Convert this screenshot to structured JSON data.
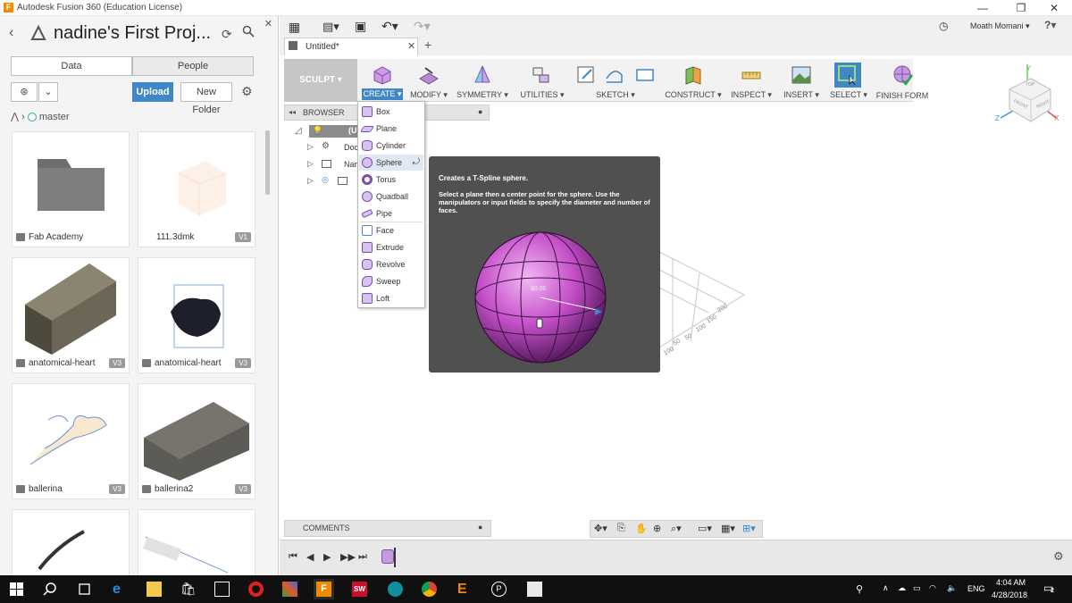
{
  "window": {
    "title": "Autodesk Fusion 360 (Education License)",
    "controls": [
      "—",
      "❐",
      "✕"
    ]
  },
  "data_panel": {
    "project_title": "nadine's First Proj...",
    "tabs": [
      "Data",
      "People"
    ],
    "upload_label": "Upload",
    "new_folder_label": "New Folder",
    "branch": "master",
    "cards": [
      {
        "name": "Fab Academy",
        "version": ""
      },
      {
        "name": "111.3dmk",
        "version": "V1"
      },
      {
        "name": "anatomical-heart",
        "version": "V3"
      },
      {
        "name": "anatomical-heart",
        "version": "V3"
      },
      {
        "name": "ballerina",
        "version": "V3"
      },
      {
        "name": "ballerina2",
        "version": "V3"
      }
    ]
  },
  "app_bar": {
    "user": "Moath Momani ▾",
    "help": "?",
    "doc_tab": "Untitled*"
  },
  "toolbar": {
    "workspace": "SCULPT ▾",
    "groups": [
      "CREATE ▾",
      "MODIFY ▾",
      "SYMMETRY ▾",
      "UTILITIES ▾",
      "SKETCH ▾",
      "CONSTRUCT ▾",
      "INSPECT ▾",
      "INSERT ▾",
      "SELECT ▾",
      "FINISH FORM"
    ]
  },
  "browser": {
    "title": "BROWSER",
    "rows": [
      "(U",
      "Doc",
      "Nam",
      ""
    ]
  },
  "create_menu": {
    "items": [
      "Box",
      "Plane",
      "Cylinder",
      "Sphere",
      "Torus",
      "Quadball",
      "Pipe",
      "Face",
      "Extrude",
      "Revolve",
      "Sweep",
      "Loft"
    ],
    "highlighted": "Sphere"
  },
  "tooltip": {
    "title": "Creates a T-Spline sphere.",
    "body": "Select a plane then a center point for the sphere. Use the manipulators or input fields to specify the diameter and number of faces.",
    "dimension_label": "80.00"
  },
  "viewcube": {
    "top": "TOP",
    "front": "FRONT",
    "right": "RIGHT"
  },
  "grid_labels": [
    "200",
    "150",
    "100",
    "50",
    "50",
    "100"
  ],
  "comments_label": "COMMENTS",
  "taskbar": {
    "language": "ENG",
    "time": "4:04 AM",
    "date": "4/28/2018",
    "notification_count": "2"
  },
  "colors": {
    "accent_blue": "#3f87c6",
    "sculpt_purple": "#b44fc0",
    "tooltip_bg": "#505050",
    "taskbar_bg": "#101010"
  }
}
